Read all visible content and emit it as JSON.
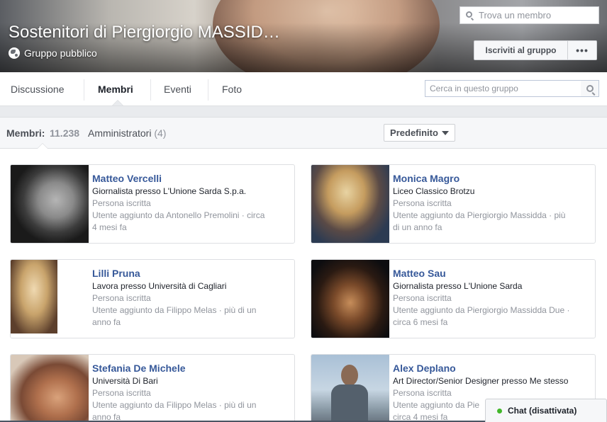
{
  "group": {
    "title": "Sostenitori di Piergiorgio MASSID…",
    "privacy": "Gruppo pubblico",
    "join_label": "Iscriviti al gruppo",
    "more_label": "•••"
  },
  "nav": {
    "tabs": [
      {
        "label": "Discussione",
        "active": false
      },
      {
        "label": "Membri",
        "active": true
      },
      {
        "label": "Eventi",
        "active": false
      },
      {
        "label": "Foto",
        "active": false
      }
    ],
    "search_placeholder": "Cerca in questo gruppo"
  },
  "members_bar": {
    "label": "Membri:",
    "count": "11.238",
    "admins_label": "Amministratori",
    "admins_count": "(4)",
    "sort_label": "Predefinito",
    "find_placeholder": "Trova un membro"
  },
  "members": [
    {
      "name": "Matteo Vercelli",
      "detail": "Giornalista presso L'Unione Sarda S.p.a.",
      "role": "Persona iscritta",
      "added_1": "Utente aggiunto da Antonello Premolini · circa",
      "added_2": "4 mesi fa"
    },
    {
      "name": "Monica Magro",
      "detail": "Liceo Classico Brotzu",
      "role": "Persona iscritta",
      "added_1": "Utente aggiunto da Piergiorgio Massidda · più",
      "added_2": "di un anno fa"
    },
    {
      "name": "Lilli Pruna",
      "detail": "Lavora presso Università di Cagliari",
      "role": "Persona iscritta",
      "added_1": "Utente aggiunto da Filippo Melas · più di un",
      "added_2": "anno fa"
    },
    {
      "name": "Matteo Sau",
      "detail": "Giornalista presso L'Unione Sarda",
      "role": "Persona iscritta",
      "added_1": "Utente aggiunto da Piergiorgio Massidda Due ·",
      "added_2": "circa 6 mesi fa"
    },
    {
      "name": "Stefania De Michele",
      "detail": "Università Di Bari",
      "role": "Persona iscritta",
      "added_1": "Utente aggiunto da Filippo Melas · più di un",
      "added_2": "anno fa"
    },
    {
      "name": "Alex Deplano",
      "detail": "Art Director/Senior Designer presso Me stesso",
      "role": "Persona iscritta",
      "added_1": "Utente aggiunto da Pie",
      "added_2": "circa 4 mesi fa"
    }
  ],
  "chat": {
    "label": "Chat (disattivata)",
    "status_color": "#42b72a"
  },
  "colors": {
    "link": "#365899",
    "muted": "#90949c",
    "text": "#1d2129"
  },
  "icons": [
    "globe-icon",
    "search-icon",
    "caret-down-icon",
    "chat-status-icon"
  ]
}
